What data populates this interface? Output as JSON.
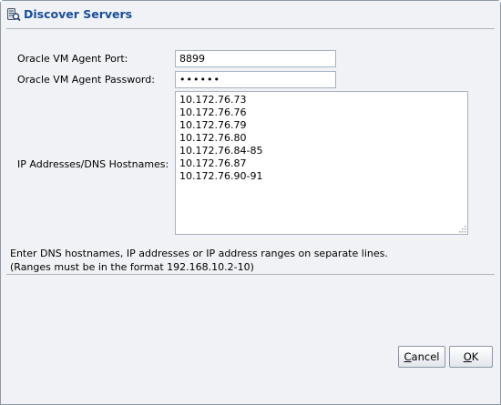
{
  "dialog": {
    "title": "Discover Servers",
    "title_icon": "server-discovery-icon"
  },
  "form": {
    "port_label": "Oracle VM Agent Port:",
    "port_value": "8899",
    "password_label": "Oracle VM Agent Password:",
    "password_value": "••••••",
    "ip_label": "IP Addresses/DNS Hostnames:",
    "ip_lines": [
      "10.172.76.73",
      "10.172.76.76",
      "10.172.76.79",
      "10.172.76.80",
      "10.172.76.84-85",
      "10.172.76.87",
      "10.172.76.90-91"
    ]
  },
  "help": {
    "line1": "Enter DNS hostnames, IP addresses or IP address ranges on separate lines.",
    "line2": "(Ranges must be in the format 192.168.10.2-10)"
  },
  "buttons": {
    "cancel_mnemonic": "C",
    "cancel_rest": "ancel",
    "ok_mnemonic": "O",
    "ok_rest": "K"
  },
  "colors": {
    "title": "#184e9c",
    "dialog_bg": "#f0f2f5",
    "border": "#a7b3c0"
  }
}
